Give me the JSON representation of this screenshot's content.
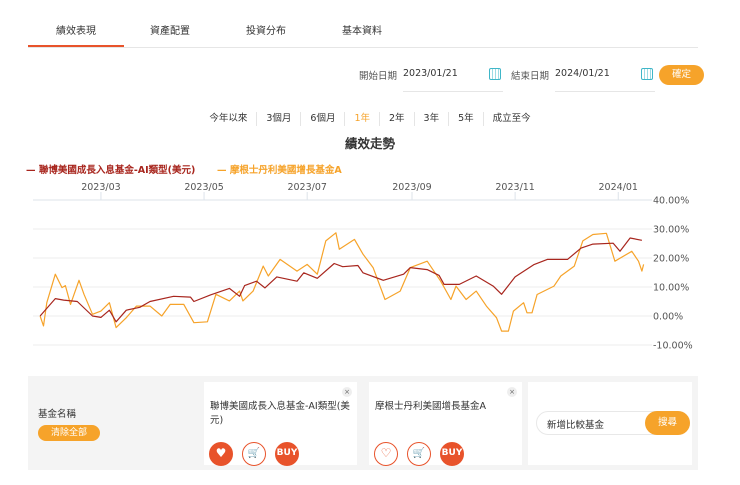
{
  "tabs": [
    "績效表現",
    "資產配置",
    "投資分布",
    "基本資料"
  ],
  "date": {
    "start_label": "開始日期",
    "start": "2023/01/21",
    "end_label": "結束日期",
    "end": "2024/01/21",
    "confirm": "確定"
  },
  "periods": [
    "今年以來",
    "3個月",
    "6個月",
    "1年",
    "2年",
    "3年",
    "5年",
    "成立至今"
  ],
  "active_period": "1年",
  "chart_data": {
    "type": "line",
    "title": "績效走勢",
    "x_unit": "days since 2023/01/21",
    "x_ticks": [
      {
        "day": 39,
        "label": "2023/03"
      },
      {
        "day": 100,
        "label": "2023/05"
      },
      {
        "day": 161,
        "label": "2023/07"
      },
      {
        "day": 223,
        "label": "2023/09"
      },
      {
        "day": 284,
        "label": "2023/11"
      },
      {
        "day": 345,
        "label": "2024/01"
      }
    ],
    "y_ticks": [
      "40.00%",
      "30.00%",
      "20.00%",
      "10.00%",
      "0.00%",
      "-10.00%"
    ],
    "ylim": [
      -10,
      40
    ],
    "xlim": [
      0,
      362
    ],
    "series": [
      {
        "name": "聯博美國成長入息基金-AI類型(美元)",
        "color": "#a8261e",
        "points": [
          [
            3,
            0
          ],
          [
            12,
            6
          ],
          [
            17,
            5.5
          ],
          [
            25,
            5
          ],
          [
            34,
            0
          ],
          [
            39,
            -0.5
          ],
          [
            44,
            2
          ],
          [
            48,
            -2
          ],
          [
            54,
            2
          ],
          [
            62,
            3
          ],
          [
            68,
            5
          ],
          [
            82,
            6.8
          ],
          [
            92,
            6.5
          ],
          [
            94,
            5
          ],
          [
            104,
            7.3
          ],
          [
            115,
            9.5
          ],
          [
            121,
            6.8
          ],
          [
            124,
            10.5
          ],
          [
            131,
            12
          ],
          [
            136,
            9.7
          ],
          [
            143,
            13.5
          ],
          [
            155,
            12
          ],
          [
            159,
            14.9
          ],
          [
            167,
            13
          ],
          [
            177,
            18.1
          ],
          [
            182,
            17
          ],
          [
            191,
            17.4
          ],
          [
            194,
            14.9
          ],
          [
            206,
            12.3
          ],
          [
            218,
            14.4
          ],
          [
            222,
            16.7
          ],
          [
            232,
            16
          ],
          [
            239,
            14
          ],
          [
            242,
            10.9
          ],
          [
            251,
            10.9
          ],
          [
            261,
            13.8
          ],
          [
            271,
            10.3
          ],
          [
            276,
            7.5
          ],
          [
            284,
            13.5
          ],
          [
            295,
            17.7
          ],
          [
            303,
            19.5
          ],
          [
            315,
            19.5
          ],
          [
            323,
            23.4
          ],
          [
            330,
            24.8
          ],
          [
            342,
            25.1
          ],
          [
            346,
            22.3
          ],
          [
            352,
            26.9
          ],
          [
            359,
            26.1
          ]
        ]
      },
      {
        "name": "摩根士丹利美國增長基金A",
        "color": "#f6a32a",
        "points": [
          [
            3,
            0
          ],
          [
            5,
            -3.4
          ],
          [
            7,
            4.6
          ],
          [
            12,
            14.4
          ],
          [
            16,
            9.8
          ],
          [
            18,
            10.5
          ],
          [
            21,
            4
          ],
          [
            26,
            12.3
          ],
          [
            29,
            7.5
          ],
          [
            34,
            0.6
          ],
          [
            39,
            1.7
          ],
          [
            44,
            4.6
          ],
          [
            48,
            -4
          ],
          [
            54,
            -0.6
          ],
          [
            60,
            3.4
          ],
          [
            68,
            3.4
          ],
          [
            75,
            0
          ],
          [
            80,
            4
          ],
          [
            88,
            4
          ],
          [
            94,
            -2.3
          ],
          [
            102,
            -2
          ],
          [
            107,
            7.5
          ],
          [
            115,
            5.2
          ],
          [
            121,
            8.6
          ],
          [
            123,
            5.2
          ],
          [
            129,
            8.6
          ],
          [
            135,
            17.2
          ],
          [
            138,
            13.8
          ],
          [
            145,
            19.5
          ],
          [
            155,
            15.5
          ],
          [
            161,
            17.8
          ],
          [
            167,
            14.4
          ],
          [
            172,
            25.9
          ],
          [
            178,
            28.7
          ],
          [
            180,
            23
          ],
          [
            189,
            26.4
          ],
          [
            194,
            21.3
          ],
          [
            200,
            16.7
          ],
          [
            207,
            5.7
          ],
          [
            216,
            8.6
          ],
          [
            222,
            16.7
          ],
          [
            232,
            18.9
          ],
          [
            240,
            12
          ],
          [
            246,
            5.7
          ],
          [
            249,
            10.3
          ],
          [
            255,
            5.7
          ],
          [
            261,
            8.6
          ],
          [
            267,
            3.4
          ],
          [
            273,
            -0.6
          ],
          [
            276,
            -5.2
          ],
          [
            280,
            -5.2
          ],
          [
            283,
            1.7
          ],
          [
            289,
            4.6
          ],
          [
            291,
            1.1
          ],
          [
            294,
            1.1
          ],
          [
            297,
            7.4
          ],
          [
            307,
            10.3
          ],
          [
            311,
            13.8
          ],
          [
            319,
            17.2
          ],
          [
            324,
            25.9
          ],
          [
            330,
            28.1
          ],
          [
            338,
            28.5
          ],
          [
            343,
            18.9
          ],
          [
            353,
            22.3
          ],
          [
            357,
            18.9
          ],
          [
            359,
            15.5
          ],
          [
            360,
            17.8
          ]
        ]
      }
    ]
  },
  "compare": {
    "fund_name_label": "基金名稱",
    "clear_all": "清除全部",
    "funds": [
      {
        "name": "聯博美國成長入息基金-AI類型(美元)",
        "favorited": true
      },
      {
        "name": "摩根士丹利美國增長基金A",
        "favorited": false
      }
    ],
    "close": "×",
    "buy": "BUY",
    "search_placeholder": "新增比較基金",
    "search_button": "搜尋"
  },
  "icons": {
    "heart": "♥",
    "heart_outline": "♡",
    "cart": "🛒"
  }
}
